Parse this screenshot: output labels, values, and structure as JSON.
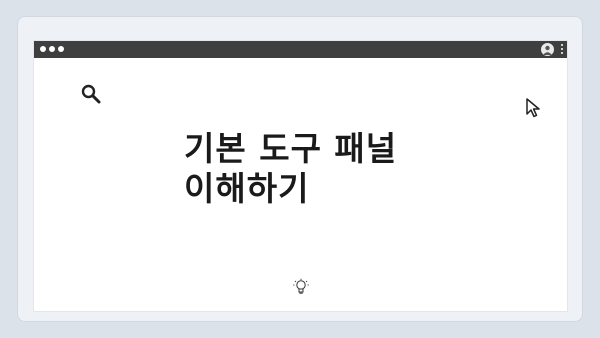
{
  "headline": {
    "line1": "기본 도구 패널",
    "line2": "이해하기"
  },
  "icons": {
    "search": "search-icon",
    "cursor": "cursor-arrow-icon",
    "idea": "lightbulb-icon",
    "user": "user-avatar-icon",
    "menu": "more-vertical-icon"
  },
  "colors": {
    "background": "#dbe2ea",
    "titlebar": "#3f3f3f",
    "text": "#1a1a1a"
  }
}
